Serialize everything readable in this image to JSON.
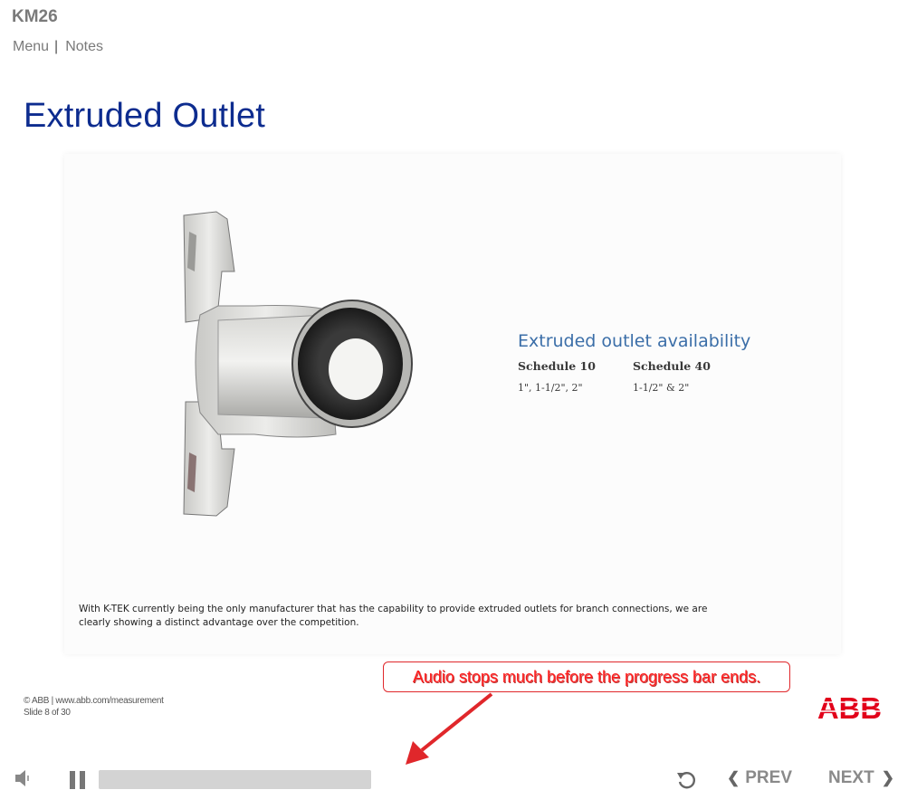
{
  "course": {
    "title": "KM26"
  },
  "nav": {
    "menu_label": "Menu",
    "separator": "|",
    "notes_label": "Notes"
  },
  "slide": {
    "title": "Extruded Outlet",
    "availability_heading": "Extruded outlet availability",
    "schedules": [
      {
        "label": "Schedule 10",
        "sizes": "1\", 1-1/2\", 2\""
      },
      {
        "label": "Schedule 40",
        "sizes": "1-1/2\" & 2\""
      }
    ],
    "caption": "With K-TEK currently being the only manufacturer that has the capability to provide extruded outlets for branch connections, we are clearly showing a distinct advantage over the competition."
  },
  "footer": {
    "copyright": "© ABB | www.abb.com/measurement",
    "slide_counter": "Slide 8 of 30"
  },
  "annotation": {
    "callout_text": "Audio stops much before the progress bar ends.",
    "color": "#e0272b"
  },
  "brand": {
    "logo_text": "ABB",
    "color": "#e2001a"
  },
  "player": {
    "volume_icon": "speaker-icon",
    "pause_icon": "pause-icon",
    "progress_percent": 100,
    "replay_icon": "replay-icon",
    "prev_label": "PREV",
    "next_label": "NEXT"
  }
}
